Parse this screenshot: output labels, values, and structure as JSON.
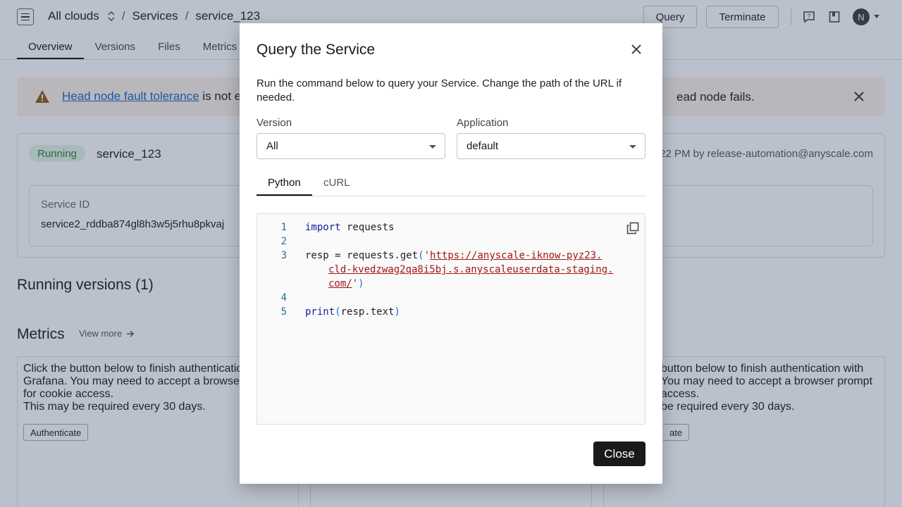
{
  "topbar": {
    "breadcrumbs": [
      "All clouds",
      "Services",
      "service_123"
    ],
    "query_label": "Query",
    "terminate_label": "Terminate",
    "avatar_initial": "N"
  },
  "tabs": [
    "Overview",
    "Versions",
    "Files",
    "Metrics"
  ],
  "alert": {
    "link_text": "Head node fault tolerance",
    "text_start": " is not e",
    "text_end": "ead node fails."
  },
  "service": {
    "status": "Running",
    "name": "service_123",
    "meta": "22 PM by release-automation@anyscale.com",
    "id_label": "Service ID",
    "id_value": "service2_rddba874gl8h3w5j5rhu8pkvaj"
  },
  "sections": {
    "running_versions": "Running versions (1)",
    "metrics": "Metrics",
    "view_more": "View more"
  },
  "metrics_cards": {
    "left_text": [
      "Click the button below to finish authenticatio",
      "Grafana. You may need to accept a browse",
      "for cookie access.",
      "This may be required every 30 days."
    ],
    "left_button": "Authenticate",
    "right_text": [
      "button below to finish authentication with",
      "You may need to accept a browser prompt",
      "access.",
      "be required every 30 days."
    ],
    "right_button": "ate"
  },
  "modal": {
    "title": "Query the Service",
    "description": "Run the command below to query your Service. Change the path of the URL if needed.",
    "version_label": "Version",
    "version_value": "All",
    "application_label": "Application",
    "application_value": "default",
    "tabs": [
      "Python",
      "cURL"
    ],
    "active_tab": "Python",
    "code": {
      "line_numbers": [
        "1",
        "2",
        "3",
        "4",
        "5"
      ],
      "import_kw": "import",
      "import_mod": " requests",
      "resp_prefix": "resp = requests.get",
      "url_1": "https://anyscale-iknow-pyz23.",
      "url_2": "cld-kvedzwag2qa8i5bj.s.anyscaleuserdata-staging.",
      "url_3": "com/",
      "print_fn": "print",
      "print_arg": "resp.text"
    },
    "close_label": "Close"
  }
}
